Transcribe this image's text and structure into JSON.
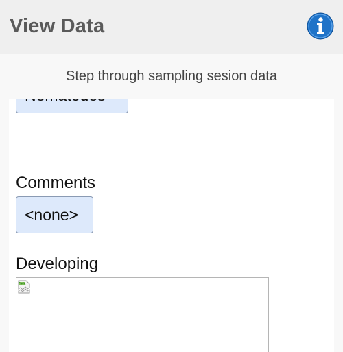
{
  "header": {
    "title": "View Data",
    "info_icon": "info-icon"
  },
  "main": {
    "subtitle": "Step through sampling sesion data",
    "sections": [
      {
        "value": "Nematodes"
      },
      {
        "label": "Comments",
        "value": "<none>"
      },
      {
        "label": "Developing",
        "image": "broken-image-icon"
      }
    ]
  },
  "colors": {
    "header_bg": "#efefef",
    "chip_bg": "#dde9fb",
    "chip_border": "#8a9ab3",
    "info_blue": "#1f73c8"
  }
}
